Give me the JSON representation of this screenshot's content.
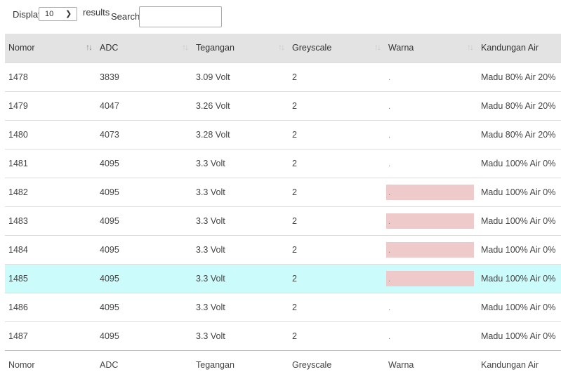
{
  "controls": {
    "display_label": "Display",
    "length_value": "10",
    "results_label": "results",
    "search_label": "Search:",
    "search_value": ""
  },
  "table": {
    "columns": [
      "Nomor",
      "ADC",
      "Tegangan",
      "Greyscale",
      "Warna",
      "Kandungan Air"
    ],
    "footer": [
      "Nomor",
      "ADC",
      "Tegangan",
      "Greyscale",
      "Warna",
      "Kandungan Air"
    ],
    "swatch_color": "#efcacb",
    "selected_row_color": "#ccfbfb",
    "rows": [
      {
        "nomor": "1478",
        "adc": "3839",
        "tegangan": "3.09 Volt",
        "greyscale": "2",
        "warna": ".",
        "kandungan": "Madu 80% Air 20%"
      },
      {
        "nomor": "1479",
        "adc": "4047",
        "tegangan": "3.26 Volt",
        "greyscale": "2",
        "warna": ".",
        "kandungan": "Madu 80% Air 20%"
      },
      {
        "nomor": "1480",
        "adc": "4073",
        "tegangan": "3.28 Volt",
        "greyscale": "2",
        "warna": ".",
        "kandungan": "Madu 80% Air 20%"
      },
      {
        "nomor": "1481",
        "adc": "4095",
        "tegangan": "3.3 Volt",
        "greyscale": "2",
        "warna": ".",
        "kandungan": "Madu 100% Air 0%"
      },
      {
        "nomor": "1482",
        "adc": "4095",
        "tegangan": "3.3 Volt",
        "greyscale": "2",
        "warna": ".",
        "kandungan": "Madu 100% Air 0%"
      },
      {
        "nomor": "1483",
        "adc": "4095",
        "tegangan": "3.3 Volt",
        "greyscale": "2",
        "warna": ".",
        "kandungan": "Madu 100% Air 0%"
      },
      {
        "nomor": "1484",
        "adc": "4095",
        "tegangan": "3.3 Volt",
        "greyscale": "2",
        "warna": ".",
        "kandungan": "Madu 100% Air 0%"
      },
      {
        "nomor": "1485",
        "adc": "4095",
        "tegangan": "3.3 Volt",
        "greyscale": "2",
        "warna": ".",
        "kandungan": "Madu 100% Air 0%"
      },
      {
        "nomor": "1486",
        "adc": "4095",
        "tegangan": "3.3 Volt",
        "greyscale": "2",
        "warna": ".",
        "kandungan": "Madu 100% Air 0%"
      },
      {
        "nomor": "1487",
        "adc": "4095",
        "tegangan": "3.3 Volt",
        "greyscale": "2",
        "warna": ".",
        "kandungan": "Madu 100% Air 0%"
      }
    ]
  }
}
